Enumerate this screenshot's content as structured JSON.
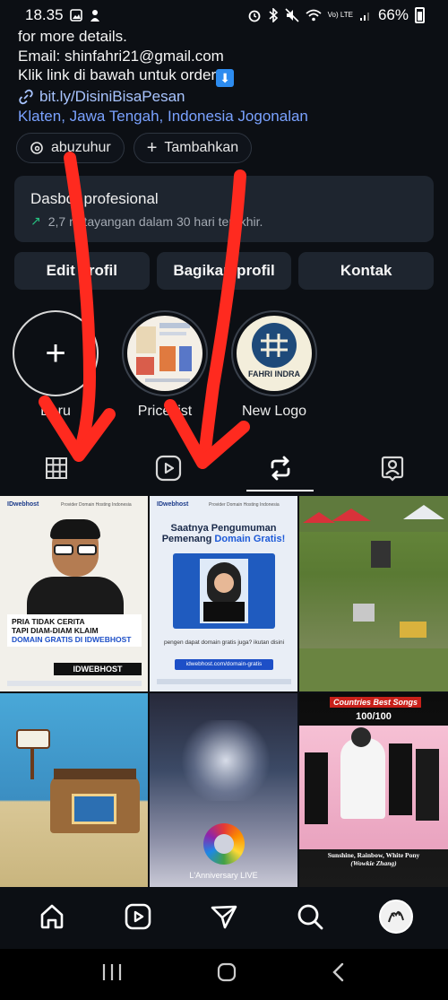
{
  "status_bar": {
    "time": "18.35",
    "battery": "66%",
    "network": "Vo) LTE"
  },
  "bio": {
    "line1": "for more details.",
    "line2": "Email: shinfahri21@gmail.com",
    "line3": "Klik link di bawah untuk order",
    "link": "bit.ly/DisiniBisaPesan",
    "location": "Klaten, Jawa Tengah, Indonesia Jogonalan"
  },
  "chips": {
    "threads_handle": "abuzuhur",
    "add_label": "Tambahkan"
  },
  "dashboard": {
    "title": "Dasbor profesional",
    "stat": "2,7 rb tayangan dalam 30 hari terakhir."
  },
  "actions": {
    "edit": "Edit profil",
    "share": "Bagikan profil",
    "contact": "Kontak"
  },
  "highlights": [
    {
      "label": "Baru"
    },
    {
      "label": "Price list"
    },
    {
      "label": "New Logo"
    }
  ],
  "new_logo_text": "FAHRI INDRA",
  "posts": {
    "p1": {
      "brand": "IDwebhost",
      "tagline": "Provider Domain Hosting Indonesia",
      "line1": "PRIA TIDAK CERITA",
      "line2": "TAPI DIAM-DIAM KLAIM",
      "line3": "DOMAIN GRATIS DI IDWEBHOST",
      "footer": "IDWEBHOST"
    },
    "p2": {
      "brand": "IDwebhost",
      "tagline": "Provider Domain Hosting Indonesia",
      "title1": "Saatnya Pengumuman",
      "title2": "Pemenang",
      "title3": "Domain Gratis!",
      "question": "pengen dapat domain gratis juga? ikutan disini",
      "url": "idwebhost.com/domain-gratis"
    },
    "p5": {
      "caption": "L'Anniversary LIVE"
    },
    "p6": {
      "header1": "Countries Best Songs",
      "header2": "100/100",
      "caption1": "Sunshine, Rainbow, White Pony",
      "caption2": "(Wowkie Zhang)"
    }
  },
  "colors": {
    "accent_link": "#a8c4ff",
    "location": "#7aa2ff",
    "annotation": "#ff2a1f",
    "card": "#1e252f"
  }
}
